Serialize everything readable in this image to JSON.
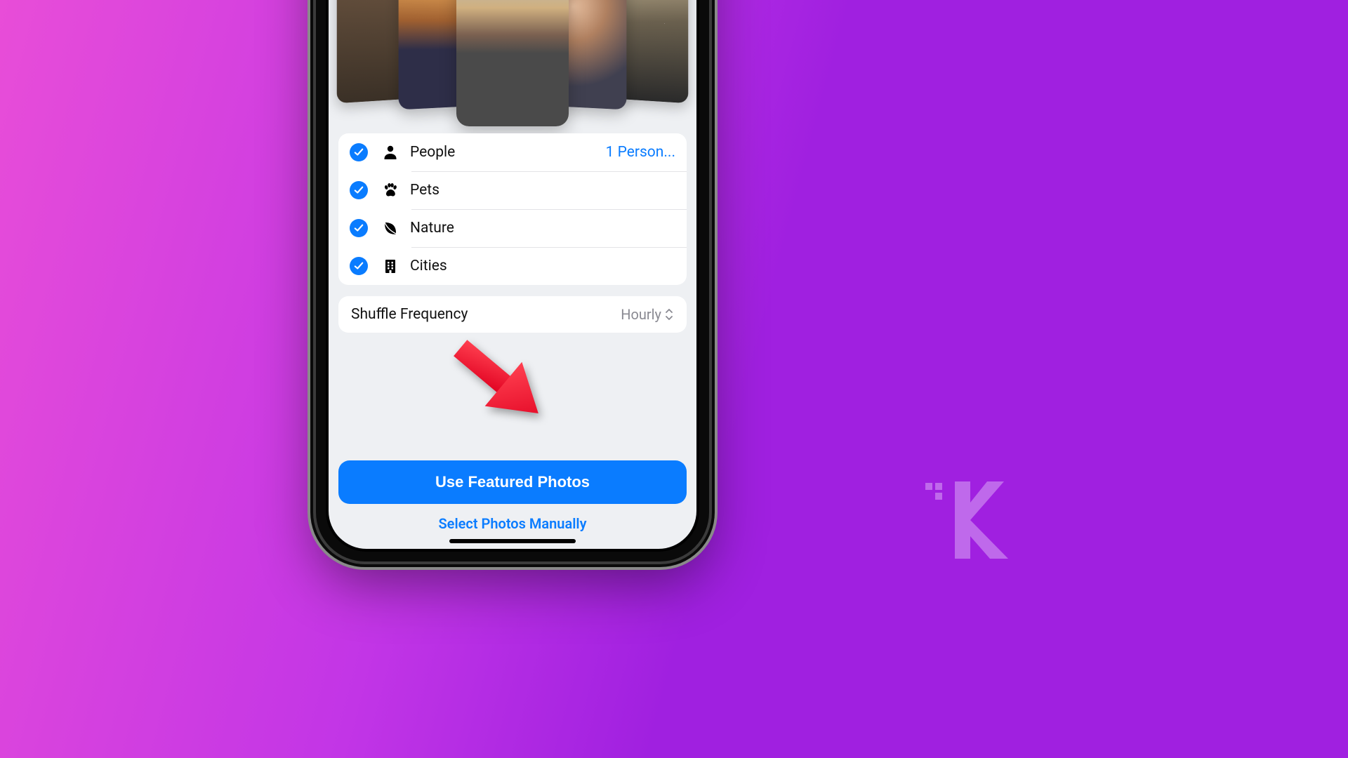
{
  "categories": [
    {
      "label": "People",
      "icon": "person",
      "detail": "1 Person..."
    },
    {
      "label": "Pets",
      "icon": "paw",
      "detail": ""
    },
    {
      "label": "Nature",
      "icon": "leaf",
      "detail": ""
    },
    {
      "label": "Cities",
      "icon": "building",
      "detail": ""
    }
  ],
  "shuffle": {
    "label": "Shuffle Frequency",
    "value": "Hourly"
  },
  "buttons": {
    "primary": "Use Featured Photos",
    "secondary": "Select Photos Manually"
  },
  "colors": {
    "accent": "#0a7cff",
    "annotation": "#ff2a3c"
  }
}
